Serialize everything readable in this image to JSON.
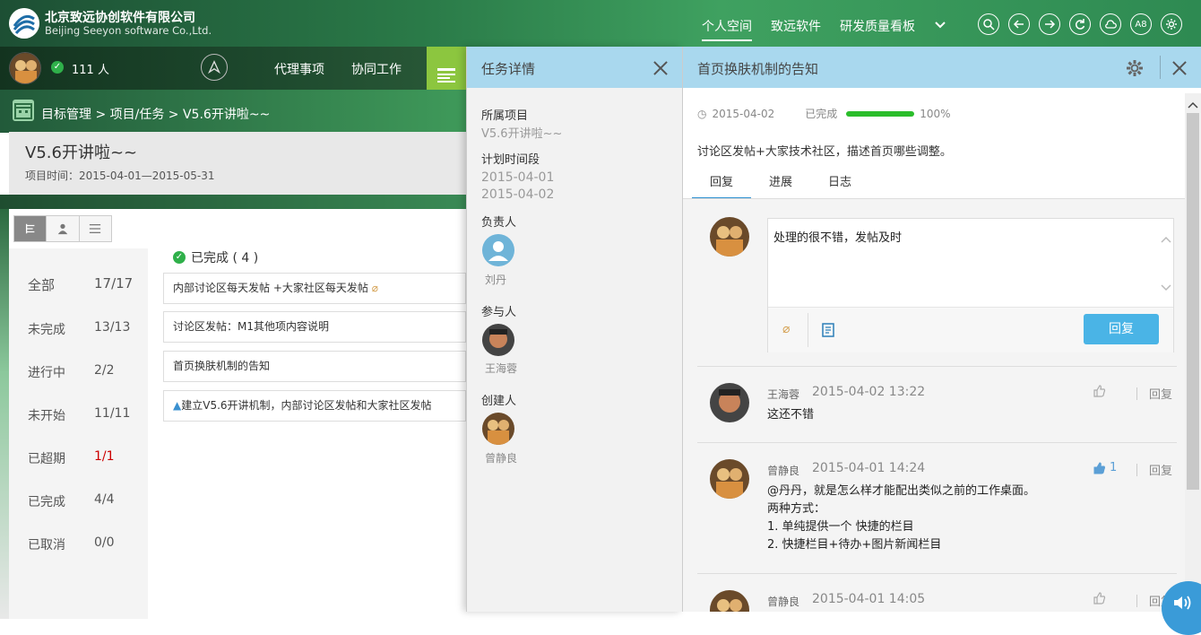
{
  "brand": {
    "name_cn": "北京致远协创软件有限公司",
    "name_en": "Beijing Seeyon software Co.,Ltd."
  },
  "topnav": {
    "items": [
      "个人空间",
      "致远软件",
      "研发质量看板"
    ],
    "icon_a8": "A8"
  },
  "user_bar": {
    "online_count": "111 人",
    "nav": [
      "代理事项",
      "协同工作"
    ]
  },
  "breadcrumb": "目标管理 > 项目/任务 > V5.6开讲啦~~",
  "project": {
    "title": "V5.6开讲啦~~",
    "time": "项目时间：2015-04-01—2015-05-31"
  },
  "stats": [
    {
      "label": "全部",
      "value": "17/17",
      "color": "#555555"
    },
    {
      "label": "未完成",
      "value": "13/13",
      "color": "#555555"
    },
    {
      "label": "进行中",
      "value": "2/2",
      "color": "#555555"
    },
    {
      "label": "未开始",
      "value": "11/11",
      "color": "#555555"
    },
    {
      "label": "已超期",
      "value": "1/1",
      "color": "#cc0000"
    },
    {
      "label": "已完成",
      "value": "4/4",
      "color": "#555555"
    },
    {
      "label": "已取消",
      "value": "0/0",
      "color": "#555555"
    }
  ],
  "completed_header": "已完成 ( 4 )",
  "tasks": [
    "内部讨论区每天发帖 +大家社区每天发帖",
    "讨论区发帖：M1其他项内容说明",
    "首页换肤机制的告知",
    "建立V5.6开讲机制，内部讨论区发帖和大家社区发帖"
  ],
  "task_detail": {
    "title": "任务详情",
    "project_label": "所属项目",
    "project_value": "V5.6开讲啦~~",
    "period_label": "计划时间段",
    "period_start": "2015-04-01",
    "period_end": "2015-04-02",
    "owner_label": "负责人",
    "owner": "刘丹",
    "participants_label": "参与人",
    "participant": "王海蓉",
    "creator_label": "创建人",
    "creator": "曾静良"
  },
  "notice": {
    "title": "首页换肤机制的告知",
    "date": "2015-04-02",
    "status": "已完成",
    "progress_percent": 100,
    "progress_label": "100%",
    "description": "讨论区发帖+大家技术社区，描述首页哪些调整。",
    "tabs": [
      "回复",
      "进展",
      "日志"
    ],
    "draft": "处理的很不错，发帖及时",
    "reply_button": "回复"
  },
  "comments": [
    {
      "name": "王海蓉",
      "time": "2015-04-02 13:22",
      "body": [
        "这还不错"
      ],
      "likes": "",
      "reply": "回复"
    },
    {
      "name": "曾静良",
      "time": "2015-04-01 14:24",
      "body": [
        "@丹丹，就是怎么样才能配出类似之前的工作桌面。",
        "两种方式：",
        "1. 单纯提供一个 快捷的栏目",
        "2. 快捷栏目+待办+图片新闻栏目"
      ],
      "likes": "1",
      "reply": "回复"
    },
    {
      "name": "曾静良",
      "time": "2015-04-01 14:05",
      "body": [],
      "likes": "",
      "reply": "回复"
    }
  ]
}
